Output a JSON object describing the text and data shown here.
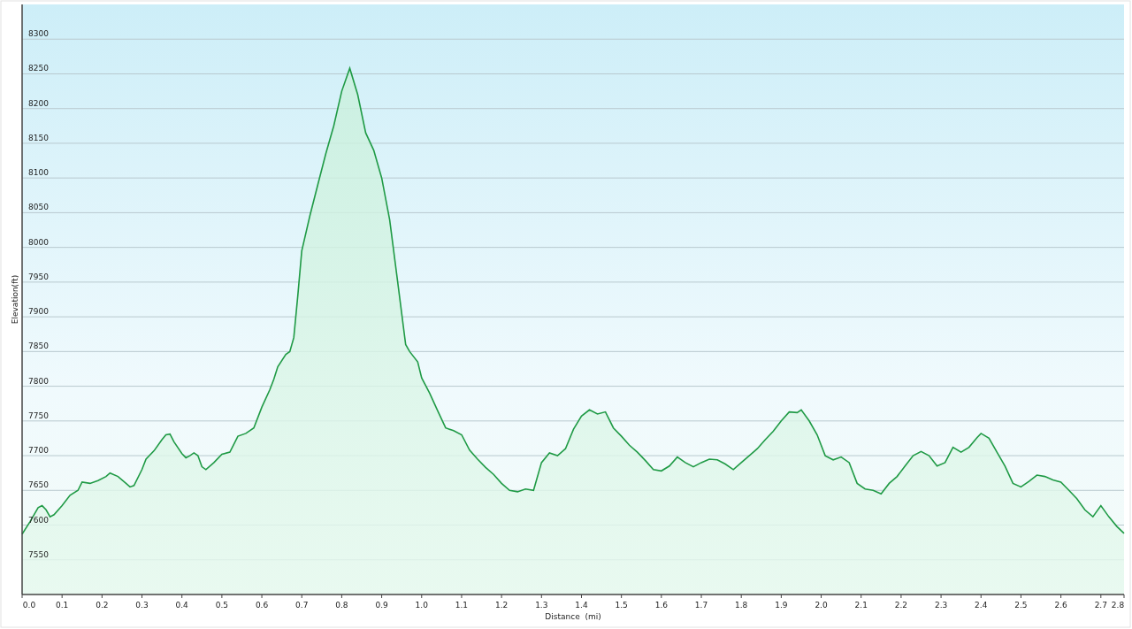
{
  "chart_data": {
    "type": "area",
    "xlabel": "Distance  (mi)",
    "ylabel": "Elevation(ft)",
    "xlim": [
      0,
      2.758
    ],
    "ylim": [
      7500,
      8350
    ],
    "grid": true,
    "xticks": [
      {
        "value": 0,
        "label": "0.0"
      },
      {
        "value": 0.1,
        "label": "0.1"
      },
      {
        "value": 0.2,
        "label": "0.2"
      },
      {
        "value": 0.3,
        "label": "0.3"
      },
      {
        "value": 0.4,
        "label": "0.4"
      },
      {
        "value": 0.5,
        "label": "0.5"
      },
      {
        "value": 0.6,
        "label": "0.6"
      },
      {
        "value": 0.7,
        "label": "0.7"
      },
      {
        "value": 0.8,
        "label": "0.8"
      },
      {
        "value": 0.9,
        "label": "0.9"
      },
      {
        "value": 1.0,
        "label": "1.0"
      },
      {
        "value": 1.1,
        "label": "1.1"
      },
      {
        "value": 1.2,
        "label": "1.2"
      },
      {
        "value": 1.3,
        "label": "1.3"
      },
      {
        "value": 1.4,
        "label": "1.4"
      },
      {
        "value": 1.5,
        "label": "1.5"
      },
      {
        "value": 1.6,
        "label": "1.6"
      },
      {
        "value": 1.7,
        "label": "1.7"
      },
      {
        "value": 1.8,
        "label": "1.8"
      },
      {
        "value": 1.9,
        "label": "1.9"
      },
      {
        "value": 2.0,
        "label": "2.0"
      },
      {
        "value": 2.1,
        "label": "2.1"
      },
      {
        "value": 2.2,
        "label": "2.2"
      },
      {
        "value": 2.3,
        "label": "2.3"
      },
      {
        "value": 2.4,
        "label": "2.4"
      },
      {
        "value": 2.5,
        "label": "2.5"
      },
      {
        "value": 2.6,
        "label": "2.6"
      },
      {
        "value": 2.7,
        "label": "2.7"
      },
      {
        "value": 2.758,
        "label": "2.8"
      }
    ],
    "yticks": [
      7550,
      7600,
      7650,
      7700,
      7750,
      7800,
      7850,
      7900,
      7950,
      8000,
      8050,
      8100,
      8150,
      8200,
      8250,
      8300
    ],
    "x": [
      0,
      0.02,
      0.04,
      0.05,
      0.06,
      0.07,
      0.08,
      0.1,
      0.12,
      0.14,
      0.15,
      0.17,
      0.19,
      0.21,
      0.22,
      0.24,
      0.26,
      0.27,
      0.28,
      0.3,
      0.31,
      0.33,
      0.35,
      0.36,
      0.37,
      0.38,
      0.4,
      0.41,
      0.42,
      0.43,
      0.44,
      0.45,
      0.46,
      0.48,
      0.5,
      0.52,
      0.54,
      0.56,
      0.58,
      0.6,
      0.62,
      0.63,
      0.64,
      0.66,
      0.67,
      0.68,
      0.69,
      0.7,
      0.72,
      0.74,
      0.76,
      0.78,
      0.8,
      0.82,
      0.84,
      0.86,
      0.88,
      0.9,
      0.92,
      0.94,
      0.96,
      0.97,
      0.99,
      1.0,
      1.02,
      1.04,
      1.06,
      1.08,
      1.1,
      1.12,
      1.14,
      1.16,
      1.18,
      1.2,
      1.22,
      1.24,
      1.26,
      1.28,
      1.3,
      1.32,
      1.34,
      1.36,
      1.38,
      1.4,
      1.42,
      1.44,
      1.46,
      1.48,
      1.5,
      1.52,
      1.54,
      1.56,
      1.58,
      1.6,
      1.62,
      1.64,
      1.66,
      1.68,
      1.7,
      1.72,
      1.74,
      1.76,
      1.78,
      1.8,
      1.82,
      1.84,
      1.86,
      1.88,
      1.9,
      1.92,
      1.94,
      1.95,
      1.97,
      1.99,
      2.01,
      2.03,
      2.05,
      2.07,
      2.09,
      2.11,
      2.13,
      2.15,
      2.17,
      2.19,
      2.21,
      2.23,
      2.25,
      2.27,
      2.29,
      2.31,
      2.33,
      2.35,
      2.37,
      2.39,
      2.4,
      2.42,
      2.44,
      2.46,
      2.48,
      2.5,
      2.52,
      2.54,
      2.56,
      2.58,
      2.6,
      2.62,
      2.64,
      2.66,
      2.68,
      2.7,
      2.72,
      2.74,
      2.758
    ],
    "series": [
      {
        "color": "#1f9a45",
        "values": [
          7587,
          7605,
          7625,
          7628,
          7622,
          7612,
          7615,
          7628,
          7643,
          7650,
          7662,
          7660,
          7664,
          7670,
          7675,
          7670,
          7660,
          7655,
          7657,
          7680,
          7695,
          7707,
          7723,
          7730,
          7731,
          7720,
          7703,
          7697,
          7700,
          7704,
          7700,
          7684,
          7680,
          7690,
          7702,
          7705,
          7728,
          7732,
          7740,
          7770,
          7795,
          7810,
          7828,
          7846,
          7850,
          7870,
          7930,
          7995,
          8045,
          8090,
          8135,
          8175,
          8225,
          8258,
          8220,
          8165,
          8140,
          8100,
          8040,
          7950,
          7860,
          7850,
          7835,
          7812,
          7790,
          7765,
          7740,
          7736,
          7730,
          7708,
          7695,
          7683,
          7673,
          7660,
          7650,
          7648,
          7652,
          7650,
          7690,
          7704,
          7700,
          7710,
          7738,
          7757,
          7766,
          7760,
          7763,
          7740,
          7728,
          7715,
          7705,
          7693,
          7680,
          7678,
          7685,
          7698,
          7690,
          7684,
          7690,
          7695,
          7694,
          7688,
          7680,
          7690,
          7700,
          7710,
          7723,
          7735,
          7750,
          7763,
          7762,
          7766,
          7750,
          7730,
          7700,
          7694,
          7698,
          7690,
          7660,
          7652,
          7650,
          7645,
          7660,
          7670,
          7685,
          7700,
          7706,
          7700,
          7685,
          7690,
          7712,
          7705,
          7712,
          7726,
          7732,
          7725,
          7705,
          7685,
          7660,
          7655,
          7663,
          7672,
          7670,
          7665,
          7662,
          7650,
          7638,
          7622,
          7612,
          7628,
          7612,
          7598,
          7588
        ]
      }
    ]
  }
}
